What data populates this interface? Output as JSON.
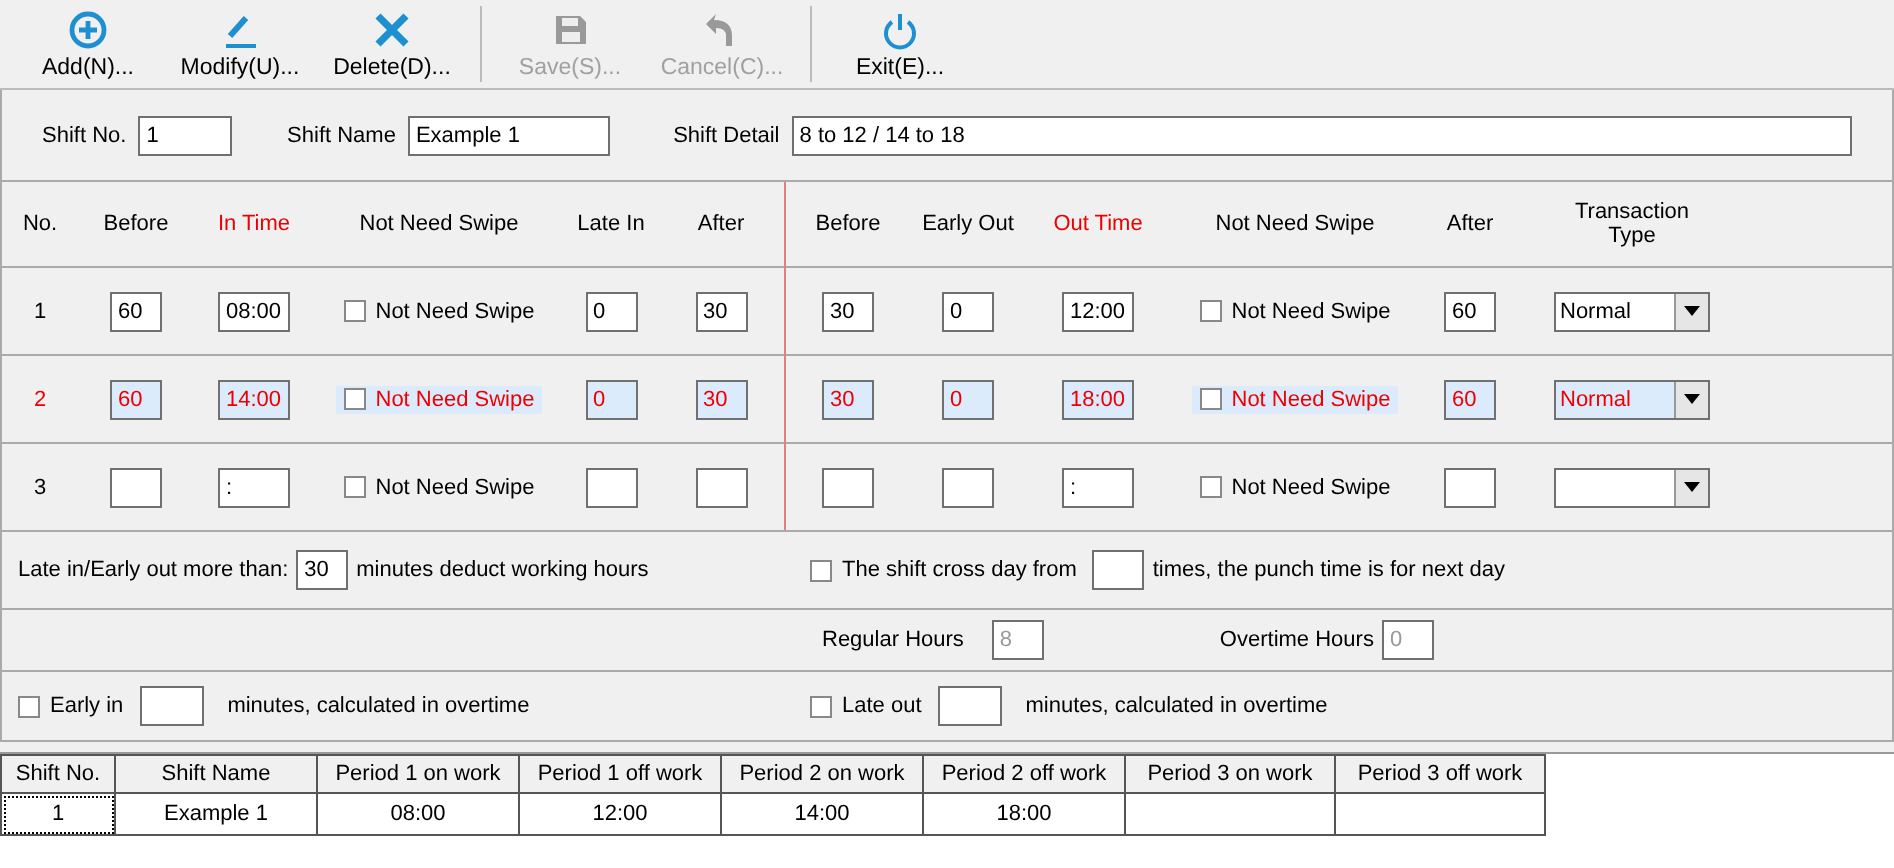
{
  "toolbar": {
    "groups": [
      [
        {
          "label": "Add(N)...",
          "kind": "add",
          "disabled": false
        },
        {
          "label": "Modify(U)...",
          "kind": "modify",
          "disabled": false
        },
        {
          "label": "Delete(D)...",
          "kind": "delete",
          "disabled": false
        }
      ],
      [
        {
          "label": "Save(S)...",
          "kind": "save",
          "disabled": true
        },
        {
          "label": "Cancel(C)...",
          "kind": "cancel",
          "disabled": true
        }
      ],
      [
        {
          "label": "Exit(E)...",
          "kind": "exit",
          "disabled": false
        }
      ]
    ]
  },
  "shift": {
    "shift_no": {
      "label": "Shift No.",
      "value": "1"
    },
    "shift_name": {
      "label": "Shift Name",
      "value": "Example 1"
    },
    "shift_detail": {
      "label": "Shift Detail",
      "value": "8 to 12 / 14 to 18"
    }
  },
  "period_headers": {
    "in": [
      {
        "label": "No.",
        "emphasis": false
      },
      {
        "label": "Before",
        "emphasis": false
      },
      {
        "label": "In Time",
        "emphasis": true
      },
      {
        "label": "Not Need Swipe",
        "emphasis": false
      },
      {
        "label": "Late In",
        "emphasis": false
      },
      {
        "label": "After",
        "emphasis": false
      }
    ],
    "out": [
      {
        "label": "Before",
        "emphasis": false
      },
      {
        "label": "Early Out",
        "emphasis": false
      },
      {
        "label": "Out Time",
        "emphasis": true
      },
      {
        "label": "Not Need Swipe",
        "emphasis": false
      },
      {
        "label": "After",
        "emphasis": false
      },
      {
        "label": "Transaction Type",
        "emphasis": false
      }
    ]
  },
  "periods": [
    {
      "no": "1",
      "selected": false,
      "before": "60",
      "in_time": "08:00",
      "in_swipe": {
        "label": "Not Need Swipe",
        "checked": false
      },
      "late_in": "0",
      "after": "30",
      "out_before": "30",
      "early_out": "0",
      "out_time": "12:00",
      "out_swipe": {
        "label": "Not Need Swipe",
        "checked": false
      },
      "out_after": "60",
      "transaction_type": "Normal"
    },
    {
      "no": "2",
      "selected": true,
      "before": "60",
      "in_time": "14:00",
      "in_swipe": {
        "label": "Not Need Swipe",
        "checked": false
      },
      "late_in": "0",
      "after": "30",
      "out_before": "30",
      "early_out": "0",
      "out_time": "18:00",
      "out_swipe": {
        "label": "Not Need Swipe",
        "checked": false
      },
      "out_after": "60",
      "transaction_type": "Normal"
    },
    {
      "no": "3",
      "selected": false,
      "in_time": ":",
      "in_swipe": {
        "label": "Not Need Swipe",
        "checked": false
      },
      "out_time": ":",
      "out_swipe": {
        "label": "Not Need Swipe",
        "checked": false
      }
    }
  ],
  "options": {
    "deduct": {
      "prefix": "Late in/Early out more than:",
      "value": "30",
      "suffix": "minutes deduct working hours"
    },
    "cross_day": {
      "checked": false,
      "prefix": "The shift cross day from",
      "suffix": "times, the punch time is for next day"
    },
    "regular_hours": {
      "label": "Regular Hours",
      "value": "8",
      "disabled": true
    },
    "overtime_hours": {
      "label": "Overtime Hours",
      "value": "0",
      "disabled": true
    },
    "early_in": {
      "checked": false,
      "prefix": "Early in",
      "suffix": "minutes, calculated in overtime"
    },
    "late_out": {
      "checked": false,
      "prefix": "Late out",
      "suffix": "minutes, calculated in overtime"
    }
  },
  "table": {
    "columns": [
      "Shift No.",
      "Shift Name",
      "Period 1 on work",
      "Period 1 off work",
      "Period 2 on work",
      "Period 2 off work",
      "Period 3 on work",
      "Period 3 off work"
    ],
    "rows": [
      {
        "cells": [
          "1",
          "Example 1",
          "08:00",
          "12:00",
          "14:00",
          "18:00"
        ]
      }
    ]
  }
}
